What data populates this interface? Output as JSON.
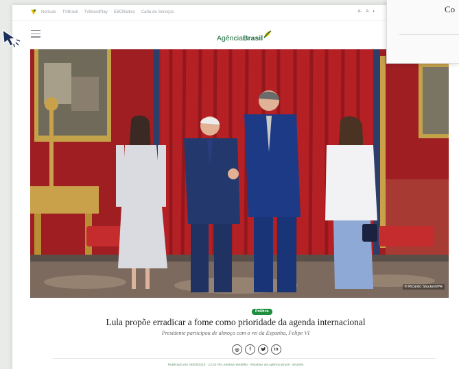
{
  "topbar": {
    "links": [
      "Notícias",
      "TVBrasil",
      "TVBrasilPlay",
      "EBCRádios",
      "Carta de Serviços"
    ],
    "font_controls": [
      "A-",
      "A",
      "◐"
    ]
  },
  "header": {
    "logo_light": "Agência",
    "logo_bold": "Brasil"
  },
  "overlay": {
    "text": "Co"
  },
  "photo": {
    "credit": "© Ricardo Stuckert/PR"
  },
  "article": {
    "category": "Política",
    "headline": "Lula propõe erradicar a fome como prioridade da agenda internacional",
    "subheadline": "Presidente participou de almoço com o rei da Espanha, Felipe VI",
    "published": "Publicado em 26/04/2023 - 13:24 Por Andreia Verdélio - Repórter da Agência Brasil - Brasília"
  },
  "share": {
    "whatsapp": "◎",
    "facebook": "f",
    "twitter": "🐦",
    "linkedin": "in"
  },
  "colors": {
    "brand_green": "#1c6b3c",
    "tag_green": "#1f8f3d",
    "curtain_red": "#b52025"
  }
}
